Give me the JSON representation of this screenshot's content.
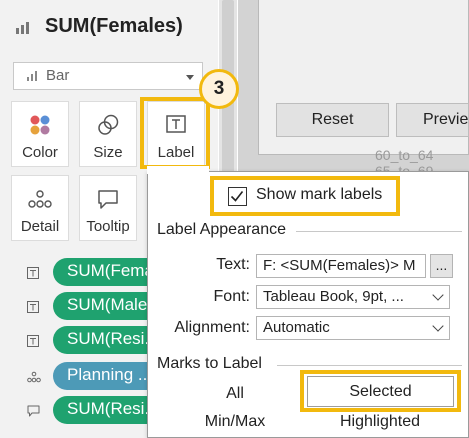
{
  "marks_card": {
    "title": "SUM(Females)",
    "mark_type": "Bar",
    "tiles": [
      {
        "label": "Color",
        "icon": "color-dots-icon"
      },
      {
        "label": "Size",
        "icon": "size-icon"
      },
      {
        "label": "Label",
        "icon": "label-text-icon"
      },
      {
        "label": "Detail",
        "icon": "detail-dots-icon"
      },
      {
        "label": "Tooltip",
        "icon": "tooltip-icon"
      }
    ],
    "fields": [
      {
        "name": "SUM(Females)",
        "encoding": "label-icon",
        "color": "#1fa26f"
      },
      {
        "name": "SUM(Males)",
        "encoding": "label-icon",
        "color": "#1fa26f"
      },
      {
        "name": "SUM(Resi...",
        "encoding": "label-icon",
        "color": "#1fa26f"
      },
      {
        "name": "Planning ...",
        "encoding": "detail-dots-icon",
        "color": "#4d9ab7"
      },
      {
        "name": "SUM(Resi...",
        "encoding": "tooltip-icon",
        "color": "#1fa26f"
      }
    ]
  },
  "step_badge": "3",
  "background": {
    "reset_button": "Reset",
    "preview_button": "Preview",
    "row_text_1": "60_to_64",
    "row_text_2": "65_to_69"
  },
  "label_popup": {
    "show_mark_labels": {
      "label": "Show mark labels",
      "checked": true
    },
    "appearance_section": "Label Appearance",
    "text_label": "Text:",
    "text_value": "F: <SUM(Females)> M",
    "text_button": "...",
    "font_label": "Font:",
    "font_value": "Tableau Book, 9pt, ...",
    "alignment_label": "Alignment:",
    "alignment_value": "Automatic",
    "marks_section": "Marks to Label",
    "options": {
      "all": "All",
      "selected": "Selected",
      "minmax": "Min/Max",
      "highlighted": "Highlighted"
    }
  },
  "colors": {
    "highlight": "#f2b90e",
    "pill_measure": "#1fa26f",
    "pill_dimension": "#4d9ab7"
  }
}
